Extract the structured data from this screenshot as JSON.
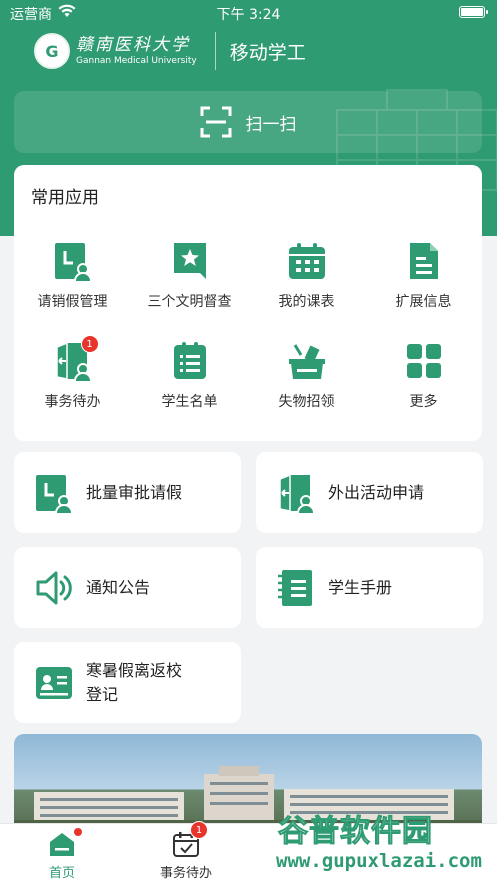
{
  "status_bar": {
    "carrier": "运营商",
    "time": "下午 3:24"
  },
  "header": {
    "logo_letter": "G",
    "school_name_cn": "赣南医科大学",
    "school_name_en": "Gannan Medical University",
    "app_title": "移动学工"
  },
  "scan": {
    "label": "扫一扫"
  },
  "common_apps": {
    "title": "常用应用",
    "items": [
      {
        "label": "请销假管理",
        "icon": "leave-request-icon"
      },
      {
        "label": "三个文明督查",
        "icon": "bookmark-star-icon"
      },
      {
        "label": "我的课表",
        "icon": "calendar-icon"
      },
      {
        "label": "扩展信息",
        "icon": "document-icon"
      },
      {
        "label": "事务待办",
        "icon": "door-person-icon",
        "badge": "1"
      },
      {
        "label": "学生名单",
        "icon": "list-icon"
      },
      {
        "label": "失物招领",
        "icon": "lost-found-icon"
      },
      {
        "label": "更多",
        "icon": "grid-icon"
      }
    ]
  },
  "tiles": [
    {
      "label": "批量审批请假",
      "icon": "leave-request-icon"
    },
    {
      "label": "外出活动申请",
      "icon": "door-person-icon"
    },
    {
      "label": "通知公告",
      "icon": "speaker-icon"
    },
    {
      "label": "学生手册",
      "icon": "notebook-icon"
    },
    {
      "label_line1": "寒暑假离返校",
      "label_line2": "登记",
      "icon": "id-card-icon"
    }
  ],
  "tabbar": {
    "tabs": [
      {
        "label": "首页",
        "active": true
      },
      {
        "label": "事务待办",
        "badge": "1"
      }
    ]
  },
  "watermark": {
    "line1": "谷普软件园",
    "line2": "www.gupuxlazai.com"
  },
  "colors": {
    "primary": "#2f9b72",
    "badge": "#e8352c",
    "background": "#f2f3f5"
  }
}
